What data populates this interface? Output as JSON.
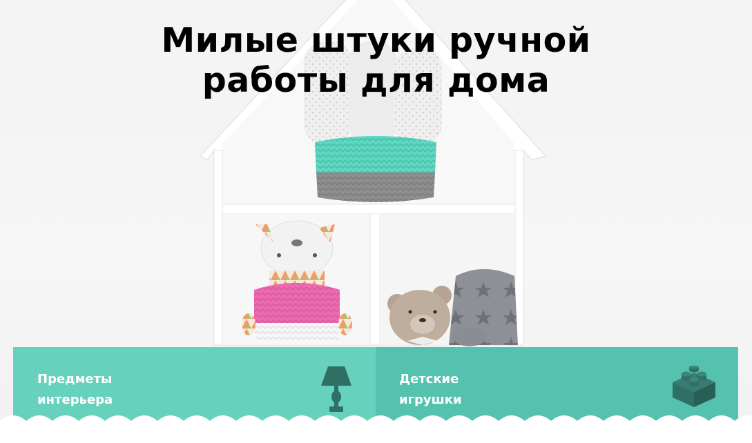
{
  "hero": {
    "headline_line1": "Милые штуки ручной",
    "headline_line2": "работы для дома"
  },
  "categories": [
    {
      "line1": "Предметы",
      "line2": "интерьера",
      "icon": "lamp-icon"
    },
    {
      "line1": "Детские",
      "line2": "игрушки",
      "icon": "toy-blocks-icon"
    }
  ],
  "colors": {
    "tile_left": "#66d1bd",
    "tile_right": "#54c2af",
    "icon_dark": "#2f6f64",
    "headline": "#000000"
  }
}
